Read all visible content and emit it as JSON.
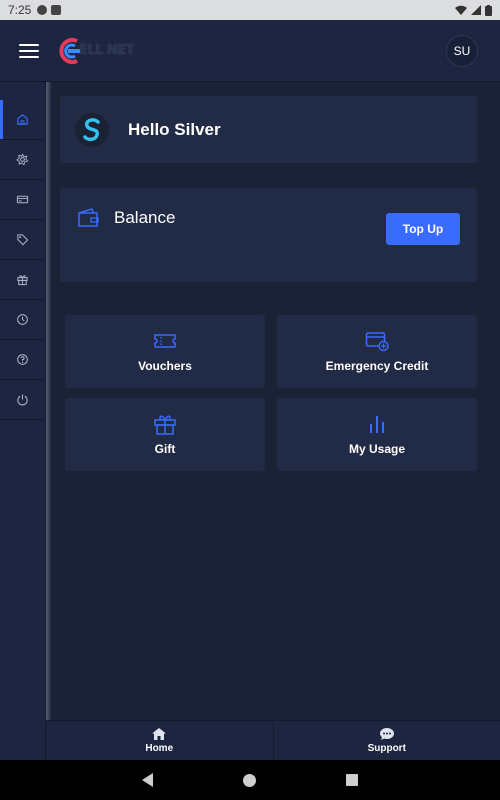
{
  "status_bar": {
    "time": "7:25"
  },
  "header": {
    "logo_text": "ELL NET",
    "avatar_initials": "SU"
  },
  "side_rail": {
    "items": [
      {
        "icon": "home-icon",
        "active": true
      },
      {
        "icon": "settings-flower-icon",
        "active": false
      },
      {
        "icon": "card-icon",
        "active": false
      },
      {
        "icon": "tag-icon",
        "active": false
      },
      {
        "icon": "gift-icon",
        "active": false
      },
      {
        "icon": "clock-icon",
        "active": false
      },
      {
        "icon": "help-icon",
        "active": false
      },
      {
        "icon": "power-icon",
        "active": false
      }
    ]
  },
  "greeting": {
    "text": "Hello Silver"
  },
  "balance": {
    "label": "Balance",
    "topup_label": "Top Up"
  },
  "tiles": [
    {
      "label": "Vouchers",
      "icon": "ticket-icon"
    },
    {
      "label": "Emergency Credit",
      "icon": "card-plus-icon"
    },
    {
      "label": "Gift",
      "icon": "gift-icon"
    },
    {
      "label": "My Usage",
      "icon": "bar-chart-icon"
    }
  ],
  "bottom_nav": {
    "home_label": "Home",
    "support_label": "Support"
  },
  "colors": {
    "accent": "#3a6bff",
    "background": "#1b2236",
    "card": "#222b45"
  }
}
